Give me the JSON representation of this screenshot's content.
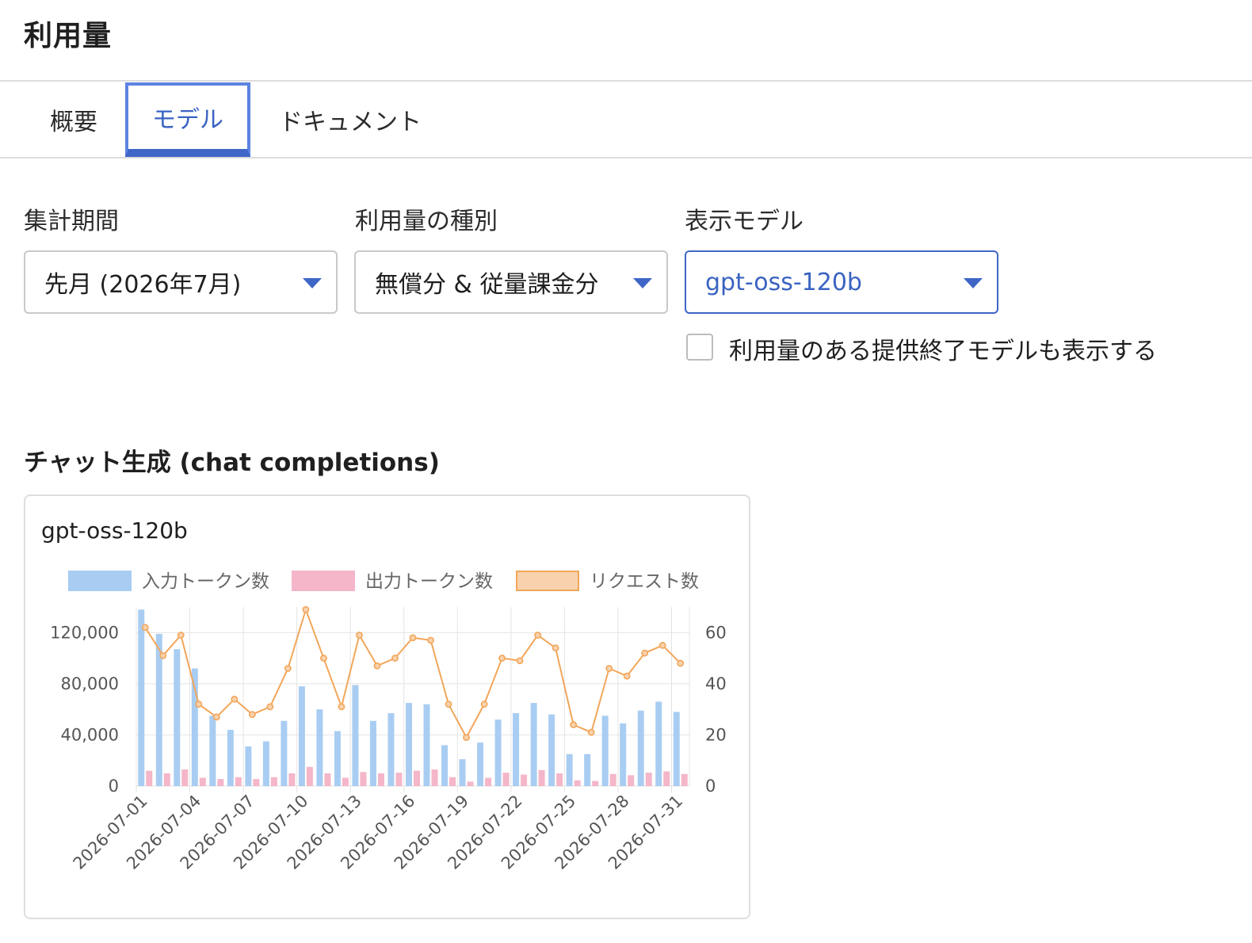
{
  "page": {
    "title": "利用量"
  },
  "tabs": [
    {
      "label": "概要",
      "active": false
    },
    {
      "label": "モデル",
      "active": true
    },
    {
      "label": "ドキュメント",
      "active": false
    }
  ],
  "filters": {
    "period": {
      "label": "集計期間",
      "value": "先月 (2026年7月)"
    },
    "usage_type": {
      "label": "利用量の種別",
      "value": "無償分 & 従量課金分"
    },
    "model": {
      "label": "表示モデル",
      "value": "gpt-oss-120b"
    },
    "show_retired": {
      "label": "利用量のある提供終了モデルも表示する",
      "checked": false
    }
  },
  "section": {
    "title": "チャット生成 (chat completions)"
  },
  "card": {
    "title": "gpt-oss-120b"
  },
  "colors": {
    "accent": "#3f66c6",
    "input_tokens": "#a9cdf2",
    "output_tokens": "#f4b6c8",
    "requests_fill": "#f8d2ad",
    "requests_line": "#f2a65a"
  },
  "chart_data": {
    "type": "bar",
    "x": [
      "2026-07-01",
      "2026-07-02",
      "2026-07-03",
      "2026-07-04",
      "2026-07-05",
      "2026-07-06",
      "2026-07-07",
      "2026-07-08",
      "2026-07-09",
      "2026-07-10",
      "2026-07-11",
      "2026-07-12",
      "2026-07-13",
      "2026-07-14",
      "2026-07-15",
      "2026-07-16",
      "2026-07-17",
      "2026-07-18",
      "2026-07-19",
      "2026-07-20",
      "2026-07-21",
      "2026-07-22",
      "2026-07-23",
      "2026-07-24",
      "2026-07-25",
      "2026-07-26",
      "2026-07-27",
      "2026-07-28",
      "2026-07-29",
      "2026-07-30",
      "2026-07-31"
    ],
    "x_tick_labels": [
      "2026-07-01",
      "2026-07-04",
      "2026-07-07",
      "2026-07-10",
      "2026-07-13",
      "2026-07-16",
      "2026-07-19",
      "2026-07-22",
      "2026-07-25",
      "2026-07-28",
      "2026-07-31"
    ],
    "series": [
      {
        "name": "入力トークン数",
        "type": "bar",
        "axis": "left",
        "values": [
          138000,
          119000,
          107000,
          92000,
          55000,
          44000,
          31000,
          35000,
          51000,
          78000,
          60000,
          43000,
          79000,
          51000,
          57000,
          65000,
          64000,
          32000,
          21000,
          34000,
          52000,
          57000,
          65000,
          56000,
          25000,
          25000,
          55000,
          49000,
          59000,
          66000,
          58000
        ]
      },
      {
        "name": "出力トークン数",
        "type": "bar",
        "axis": "left",
        "values": [
          12000,
          10000,
          13000,
          6500,
          5500,
          7000,
          5500,
          7000,
          10000,
          15000,
          10000,
          6500,
          11000,
          10000,
          10500,
          12000,
          13000,
          7000,
          3500,
          6500,
          10500,
          9000,
          12500,
          10000,
          4500,
          4000,
          9500,
          8500,
          10500,
          11500,
          9500
        ]
      },
      {
        "name": "リクエスト数",
        "type": "line",
        "axis": "right",
        "values": [
          62,
          51,
          59,
          32,
          27,
          34,
          28,
          31,
          46,
          69,
          50,
          31,
          59,
          47,
          50,
          58,
          57,
          32,
          19,
          32,
          50,
          49,
          59,
          54,
          24,
          21,
          46,
          43,
          52,
          55,
          48
        ]
      }
    ],
    "y_left": {
      "ticks": [
        "0",
        "40,000",
        "80,000",
        "120,000"
      ],
      "range": [
        0,
        140000
      ]
    },
    "y_right": {
      "ticks": [
        "0",
        "20",
        "40",
        "60"
      ],
      "range": [
        0,
        70
      ]
    },
    "legend": "top",
    "grid": true
  }
}
